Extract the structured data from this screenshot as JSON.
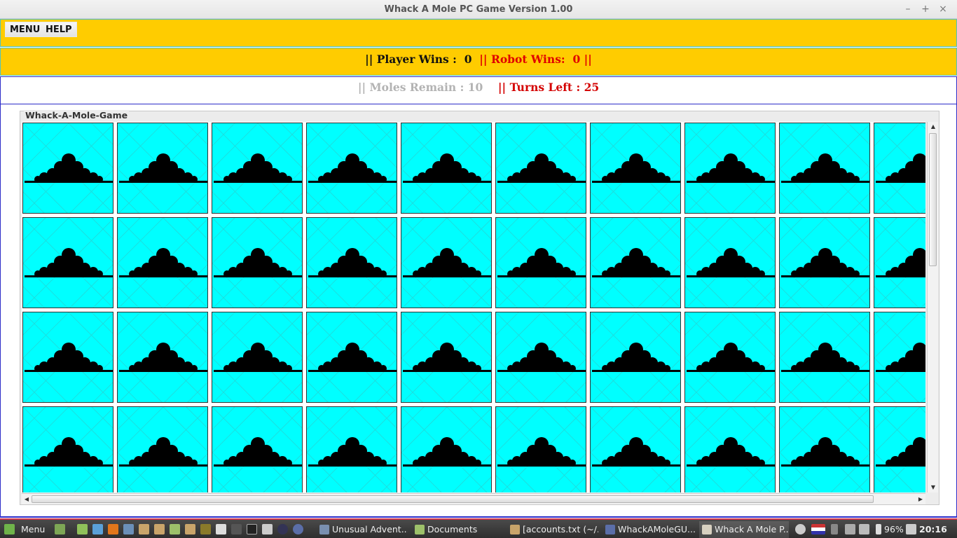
{
  "window": {
    "title": "Whack A Mole PC Game Version 1.00",
    "minimize_glyph": "–",
    "maximize_glyph": "+",
    "close_glyph": "×"
  },
  "menu": {
    "menu_label": "MENU",
    "help_label": "HELP"
  },
  "score": {
    "player_label": "|| Player Wins :",
    "player_value": "0",
    "robot_label": "|| Robot Wins:",
    "robot_value": "0",
    "robot_suffix": "||"
  },
  "status": {
    "moles_label": "|| Moles Remain : 10",
    "turns_label": "|| Turns Left : 25"
  },
  "game": {
    "group_title": "Whack-A-Mole-Game",
    "cell_color": "#00ffff",
    "mound_color": "#000000",
    "cell_icon": "dirt-mound-icon"
  },
  "taskbar": {
    "menu_label": "Menu",
    "windows": [
      {
        "label": "Unusual Advent...",
        "icon": "browser-window-icon"
      },
      {
        "label": "Documents",
        "icon": "folder-icon"
      },
      {
        "label": "[accounts.txt (~/...",
        "icon": "text-editor-icon"
      },
      {
        "label": "WhackAMoleGU...",
        "icon": "ide-icon"
      },
      {
        "label": "Whack A Mole P...",
        "icon": "java-app-icon",
        "active": true
      }
    ],
    "battery": "96%",
    "clock": "20:16"
  }
}
